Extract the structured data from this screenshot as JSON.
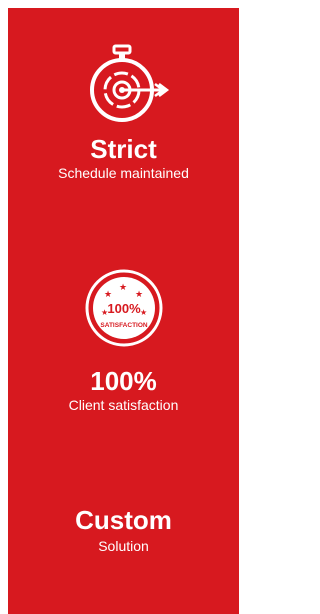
{
  "colors": {
    "panel_background": "#d7191f",
    "text": "#ffffff"
  },
  "features": [
    {
      "icon": "stopwatch-target-icon",
      "headline": "Strict",
      "subtitle": "Schedule maintained"
    },
    {
      "icon": "satisfaction-badge-icon",
      "badge_percent": "100%",
      "badge_text": "SATISFACTION",
      "headline": "100%",
      "subtitle": "Client satisfaction"
    },
    {
      "headline": "Custom",
      "subtitle": "Solution"
    }
  ]
}
